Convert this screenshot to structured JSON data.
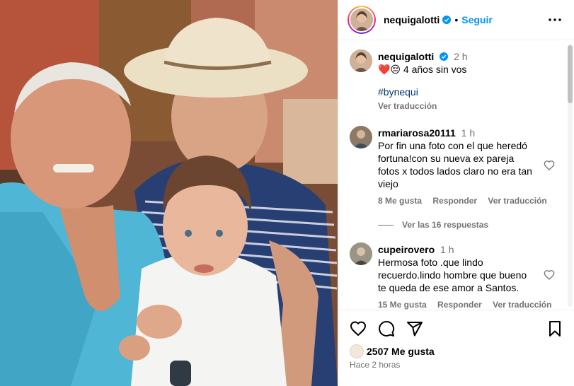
{
  "post": {
    "username": "nequigalotti",
    "follow_label": "Seguir",
    "dot": "•"
  },
  "caption": {
    "username": "nequigalotti",
    "time": "2 h",
    "emoji": "❤️😔",
    "text": "4 años sin vos",
    "hashtag": "#bynequi",
    "translate": "Ver traducción"
  },
  "comments": [
    {
      "username": "rmariarosa20111",
      "time": "1 h",
      "text": "Por fin una foto con el que heredó fortuna!con su nueva ex pareja fotos x todos lados claro no era tan viejo",
      "likes": "8 Me gusta",
      "reply": "Responder",
      "translate": "Ver traducción",
      "replies": "Ver las 16 respuestas"
    },
    {
      "username": "cupeirovero",
      "time": "1 h",
      "text": "Hermosa foto .que lindo recuerdo.lindo hombre que bueno te queda de ese amor a Santos.",
      "likes": "15 Me gusta",
      "reply": "Responder",
      "translate": "Ver traducción"
    }
  ],
  "footer": {
    "likes": "2507 Me gusta",
    "ago": "Hace 2 horas"
  },
  "icons": {
    "more": "more-options-icon",
    "like": "heart-icon",
    "comment": "comment-icon",
    "share": "paper-plane-icon",
    "save": "bookmark-icon",
    "verified": "verified-badge-icon"
  },
  "colors": {
    "accent": "#0095f6",
    "secondary_text": "#737373",
    "hashtag": "#00376b",
    "verified": "#0095f6"
  }
}
